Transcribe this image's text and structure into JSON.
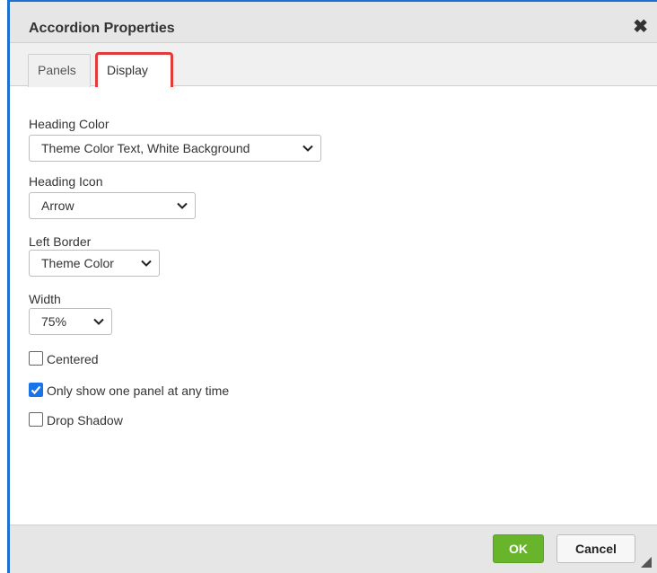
{
  "dialog": {
    "title": "Accordion Properties",
    "close_glyph": "✖",
    "accent_color": "#1f6fd0"
  },
  "tabs": [
    {
      "label": "Panels",
      "active": false
    },
    {
      "label": "Display",
      "active": true,
      "highlight_color": "#e33b3b"
    }
  ],
  "fields": {
    "heading_color": {
      "label": "Heading Color",
      "value": "Theme Color Text, White Background"
    },
    "heading_icon": {
      "label": "Heading Icon",
      "value": "Arrow"
    },
    "left_border": {
      "label": "Left Border",
      "value": "Theme Color"
    },
    "width": {
      "label": "Width",
      "value": "75%"
    }
  },
  "checkboxes": [
    {
      "label": "Centered",
      "checked": false
    },
    {
      "label": "Only show one panel at any time",
      "checked": true
    },
    {
      "label": "Drop Shadow",
      "checked": false
    }
  ],
  "footer": {
    "ok_label": "OK",
    "cancel_label": "Cancel",
    "ok_color": "#68b52c"
  },
  "icons": {
    "close": "close-icon",
    "dropdown": "chevron-down-icon",
    "check": "checkmark-icon",
    "resize": "resize-grip-icon"
  }
}
